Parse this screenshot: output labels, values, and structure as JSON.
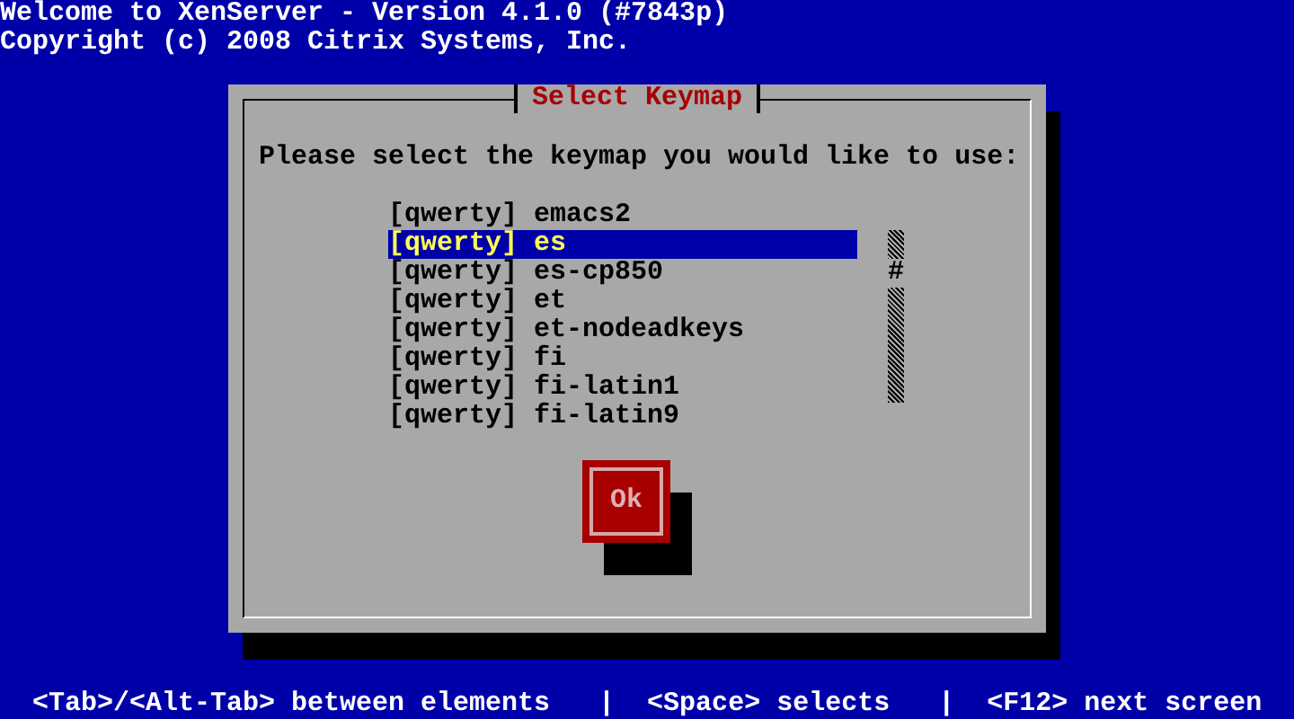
{
  "header_lines": [
    "Welcome to XenServer - Version 4.1.0 (#7843p)",
    "Copyright (c) 2008 Citrix Systems, Inc."
  ],
  "dialog": {
    "title": "Select Keymap",
    "prompt": "Please select the keymap you would like to use:",
    "keymaps": [
      {
        "label": "[qwerty] emacs2",
        "selected": false
      },
      {
        "label": "[qwerty] es",
        "selected": true
      },
      {
        "label": "[qwerty] es-cp850",
        "selected": false
      },
      {
        "label": "[qwerty] et",
        "selected": false
      },
      {
        "label": "[qwerty] et-nodeadkeys",
        "selected": false
      },
      {
        "label": "[qwerty] fi",
        "selected": false
      },
      {
        "label": "[qwerty] fi-latin1",
        "selected": false
      },
      {
        "label": "[qwerty] fi-latin9",
        "selected": false
      }
    ],
    "scrollbar": {
      "thumb": "#"
    },
    "buttons": [
      "Ok"
    ]
  },
  "status_bar": "<Tab>/<Alt-Tab> between elements   |  <Space> selects   |  <F12> next screen"
}
